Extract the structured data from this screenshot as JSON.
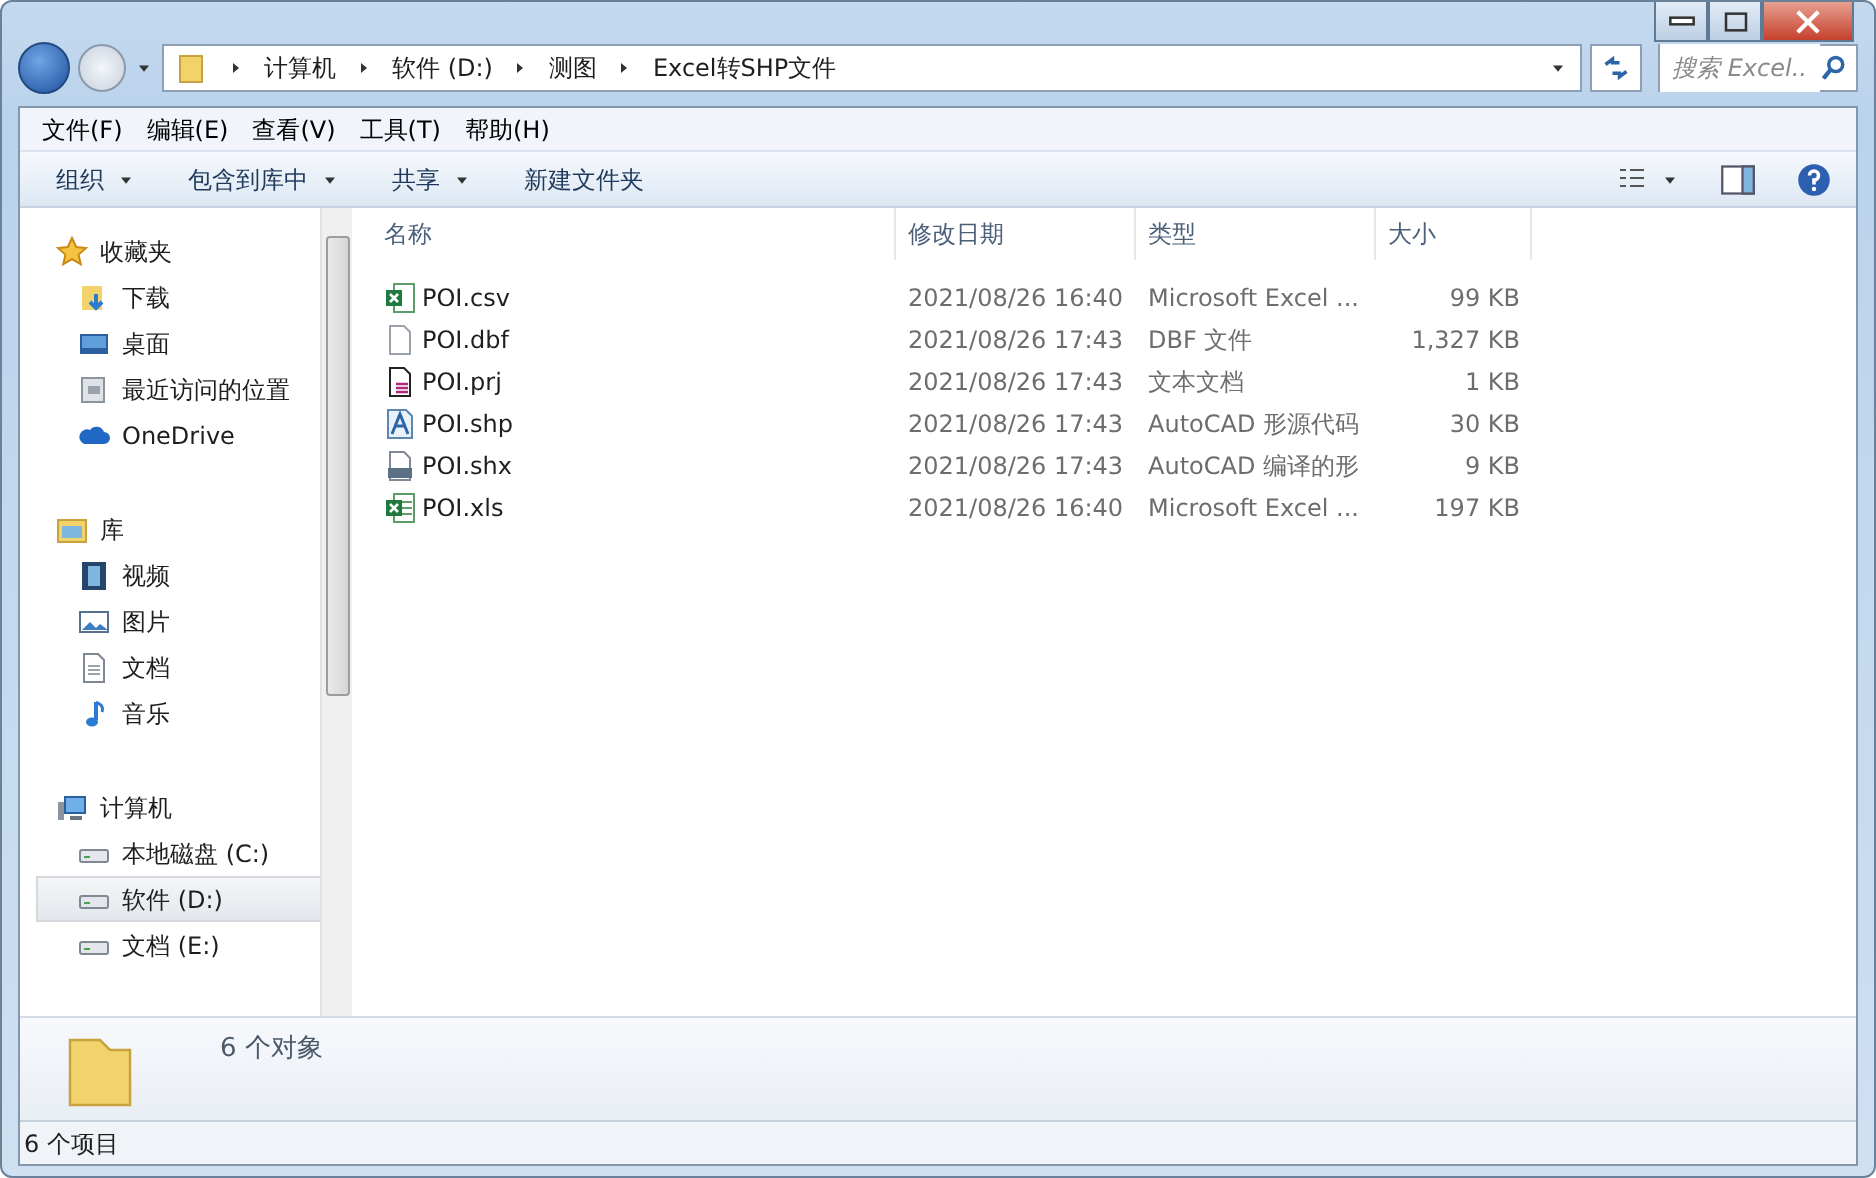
{
  "address_bar": {
    "crumbs": [
      "计算机",
      "软件 (D:)",
      "测图",
      "Excel转SHP文件"
    ],
    "search": {
      "placeholder": "搜索 Excel..."
    }
  },
  "menu_bar": [
    "文件(F)",
    "编辑(E)",
    "查看(V)",
    "工具(T)",
    "帮助(H)"
  ],
  "toolbar": [
    {
      "label": "组织",
      "dropdown": true
    },
    {
      "label": "包含到库中",
      "dropdown": true
    },
    {
      "label": "共享",
      "dropdown": true
    },
    {
      "label": "新建文件夹",
      "dropdown": false
    }
  ],
  "sidebar": {
    "groups": [
      {
        "label": "收藏夹",
        "kind": "star",
        "items": [
          {
            "label": "下载",
            "kind": "download",
            "selected": false
          },
          {
            "label": "桌面",
            "kind": "desktop",
            "selected": false
          },
          {
            "label": "最近访问的位置",
            "kind": "recent",
            "selected": false
          },
          {
            "label": "OneDrive",
            "kind": "cloud",
            "selected": false
          }
        ]
      },
      {
        "label": "库",
        "kind": "library",
        "items": [
          {
            "label": "视频",
            "kind": "video",
            "selected": false
          },
          {
            "label": "图片",
            "kind": "picture",
            "selected": false
          },
          {
            "label": "文档",
            "kind": "document",
            "selected": false
          },
          {
            "label": "音乐",
            "kind": "music",
            "selected": false
          }
        ]
      },
      {
        "label": "计算机",
        "kind": "computer",
        "items": [
          {
            "label": "本地磁盘 (C:)",
            "kind": "drive",
            "selected": false
          },
          {
            "label": "软件 (D:)",
            "kind": "drive",
            "selected": true
          },
          {
            "label": "文档 (E:)",
            "kind": "drive",
            "selected": false
          }
        ]
      }
    ]
  },
  "table": {
    "columns": [
      "名称",
      "修改日期",
      "类型",
      "大小"
    ],
    "rows": [
      {
        "kind": "csv",
        "name": "POI.csv",
        "date": "2021/08/26 16:40",
        "type": "Microsoft Excel ...",
        "size": "99 KB"
      },
      {
        "kind": "blank",
        "name": "POI.dbf",
        "date": "2021/08/26 17:43",
        "type": "DBF 文件",
        "size": "1,327 KB"
      },
      {
        "kind": "text",
        "name": "POI.prj",
        "date": "2021/08/26 17:43",
        "type": "文本文档",
        "size": "1 KB"
      },
      {
        "kind": "shape",
        "name": "POI.shp",
        "date": "2021/08/26 17:43",
        "type": "AutoCAD 形源代码",
        "size": "30 KB"
      },
      {
        "kind": "shx",
        "name": "POI.shx",
        "date": "2021/08/26 17:43",
        "type": "AutoCAD 编译的形",
        "size": "9 KB"
      },
      {
        "kind": "xls",
        "name": "POI.xls",
        "date": "2021/08/26 16:40",
        "type": "Microsoft Excel ...",
        "size": "197 KB"
      }
    ]
  },
  "details_pane": {
    "text": "6 个对象"
  },
  "status_bar": "6 个项目"
}
